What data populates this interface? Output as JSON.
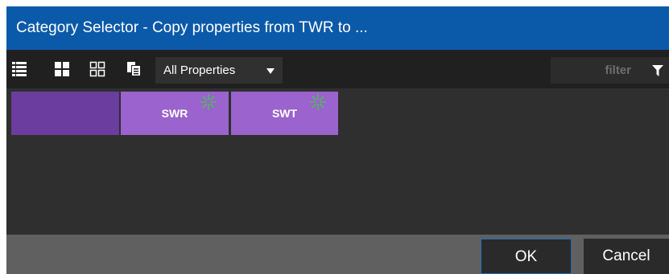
{
  "dialog": {
    "title": "Category Selector - Copy properties from TWR to ..."
  },
  "toolbar": {
    "view_icons": [
      "list-view-icon",
      "large-grid-icon",
      "small-grid-icon",
      "copy-icon"
    ],
    "select": {
      "value": "All Properties"
    },
    "filter": {
      "placeholder": "filter",
      "icon": "funnel-icon"
    }
  },
  "tiles": [
    {
      "label": "",
      "color": "#6a3d9e",
      "spark": false
    },
    {
      "label": "SWR",
      "color": "#9a63cd",
      "spark": true
    },
    {
      "label": "SWT",
      "color": "#9a63cd",
      "spark": true
    }
  ],
  "footer": {
    "ok_label": "OK",
    "cancel_label": "Cancel"
  },
  "colors": {
    "titlebar": "#0b5aa9",
    "toolbar": "#202020",
    "body": "#2f2f2f",
    "footer": "#606060",
    "tile_selected": "#6a3d9e",
    "tile": "#9a63cd",
    "spark": "#3ad23a",
    "ok_border": "#1f6fbf"
  }
}
